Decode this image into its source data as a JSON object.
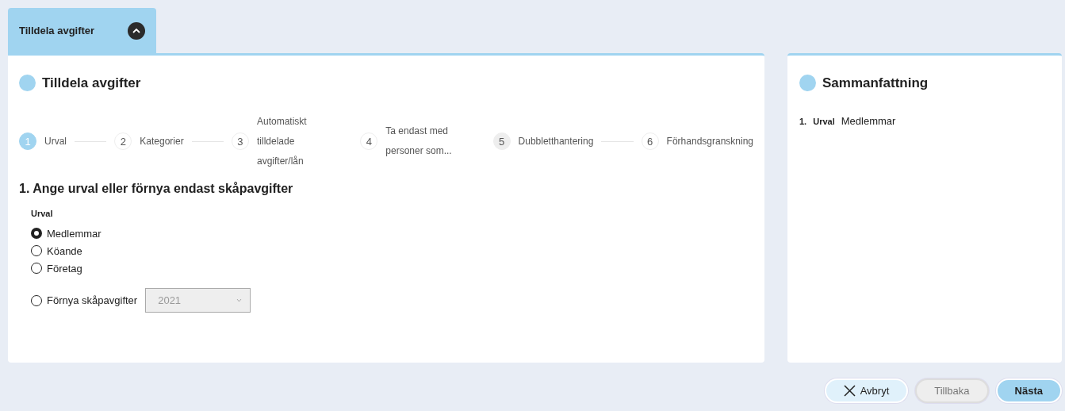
{
  "tab": {
    "label": "Tilldela avgifter",
    "expanded": true
  },
  "main": {
    "title": "Tilldela avgifter",
    "steps": [
      {
        "number": "1",
        "label": "Urval",
        "selected": true,
        "highlighted": false,
        "connector": true
      },
      {
        "number": "2",
        "label": "Kategorier",
        "selected": false,
        "highlighted": false,
        "connector": true
      },
      {
        "number": "3",
        "label": "Automatiskt tilldelade avgifter/lån",
        "selected": false,
        "highlighted": false,
        "connector": false
      },
      {
        "number": "4",
        "label": "Ta endast med personer som...",
        "selected": false,
        "highlighted": false,
        "connector": false
      },
      {
        "number": "5",
        "label": "Dubbletthantering",
        "selected": false,
        "highlighted": true,
        "connector": true
      },
      {
        "number": "6",
        "label": "Förhandsgranskning",
        "selected": false,
        "highlighted": false,
        "connector": false
      }
    ],
    "section_title": "1. Ange urval eller förnya endast skåpavgifter",
    "group_label": "Urval",
    "options": [
      {
        "label": "Medlemmar",
        "selected": true
      },
      {
        "label": "Köande",
        "selected": false
      },
      {
        "label": "Företag",
        "selected": false
      }
    ],
    "renew": {
      "label": "Förnya skåpavgifter",
      "selected": false,
      "year": "2021",
      "disabled": true
    }
  },
  "summary": {
    "title": "Sammanfattning",
    "items": [
      {
        "number": "1.",
        "label": "Urval",
        "value": "Medlemmar"
      }
    ]
  },
  "buttons": [
    {
      "label": "Avbryt",
      "kind": "cancel",
      "disabled": false
    },
    {
      "label": "Tillbaka",
      "kind": "back",
      "disabled": true
    },
    {
      "label": "Nästa",
      "kind": "primary",
      "disabled": false
    }
  ]
}
